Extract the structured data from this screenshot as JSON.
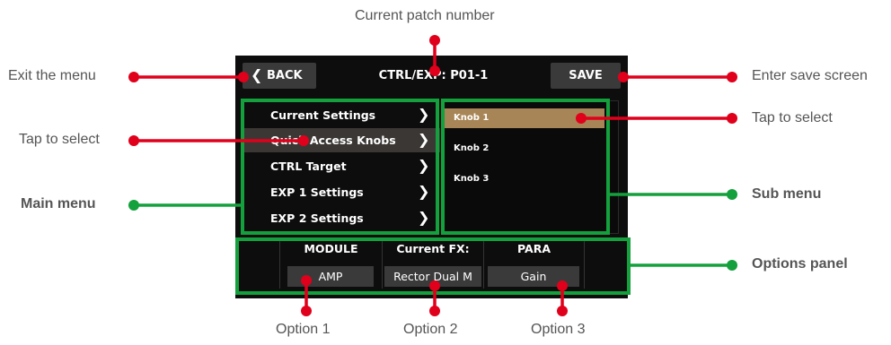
{
  "screen": {
    "back_label": "BACK",
    "title": "CTRL/EXP: P01-1",
    "save_label": "SAVE",
    "main_menu": [
      {
        "label": "Current Settings"
      },
      {
        "label": "Quick Access Knobs"
      },
      {
        "label": "CTRL Target"
      },
      {
        "label": "EXP 1 Settings"
      },
      {
        "label": "EXP 2 Settings"
      }
    ],
    "main_selected_index": 1,
    "sub_menu": [
      {
        "label": "Knob 1"
      },
      {
        "label": "Knob 2"
      },
      {
        "label": "Knob 3"
      }
    ],
    "sub_selected_index": 0,
    "options": {
      "module_head": "MODULE",
      "module_value": "AMP",
      "fx_head": "Current FX:",
      "fx_value": "Rector Dual M",
      "para_head": "PARA",
      "para_value": "Gain"
    }
  },
  "callouts": {
    "current_patch": "Current patch number",
    "exit_menu": "Exit the menu",
    "enter_save": "Enter save screen",
    "tap_select_left": "Tap to select",
    "tap_select_right": "Tap to select",
    "main_menu": "Main menu",
    "sub_menu": "Sub menu",
    "options_panel": "Options panel",
    "option1": "Option 1",
    "option2": "Option 2",
    "option3": "Option 3"
  },
  "colors": {
    "red_callout": "#e0001b",
    "green_callout": "#14a03c",
    "selected_main": "#3b3735",
    "selected_sub": "#a88556"
  }
}
